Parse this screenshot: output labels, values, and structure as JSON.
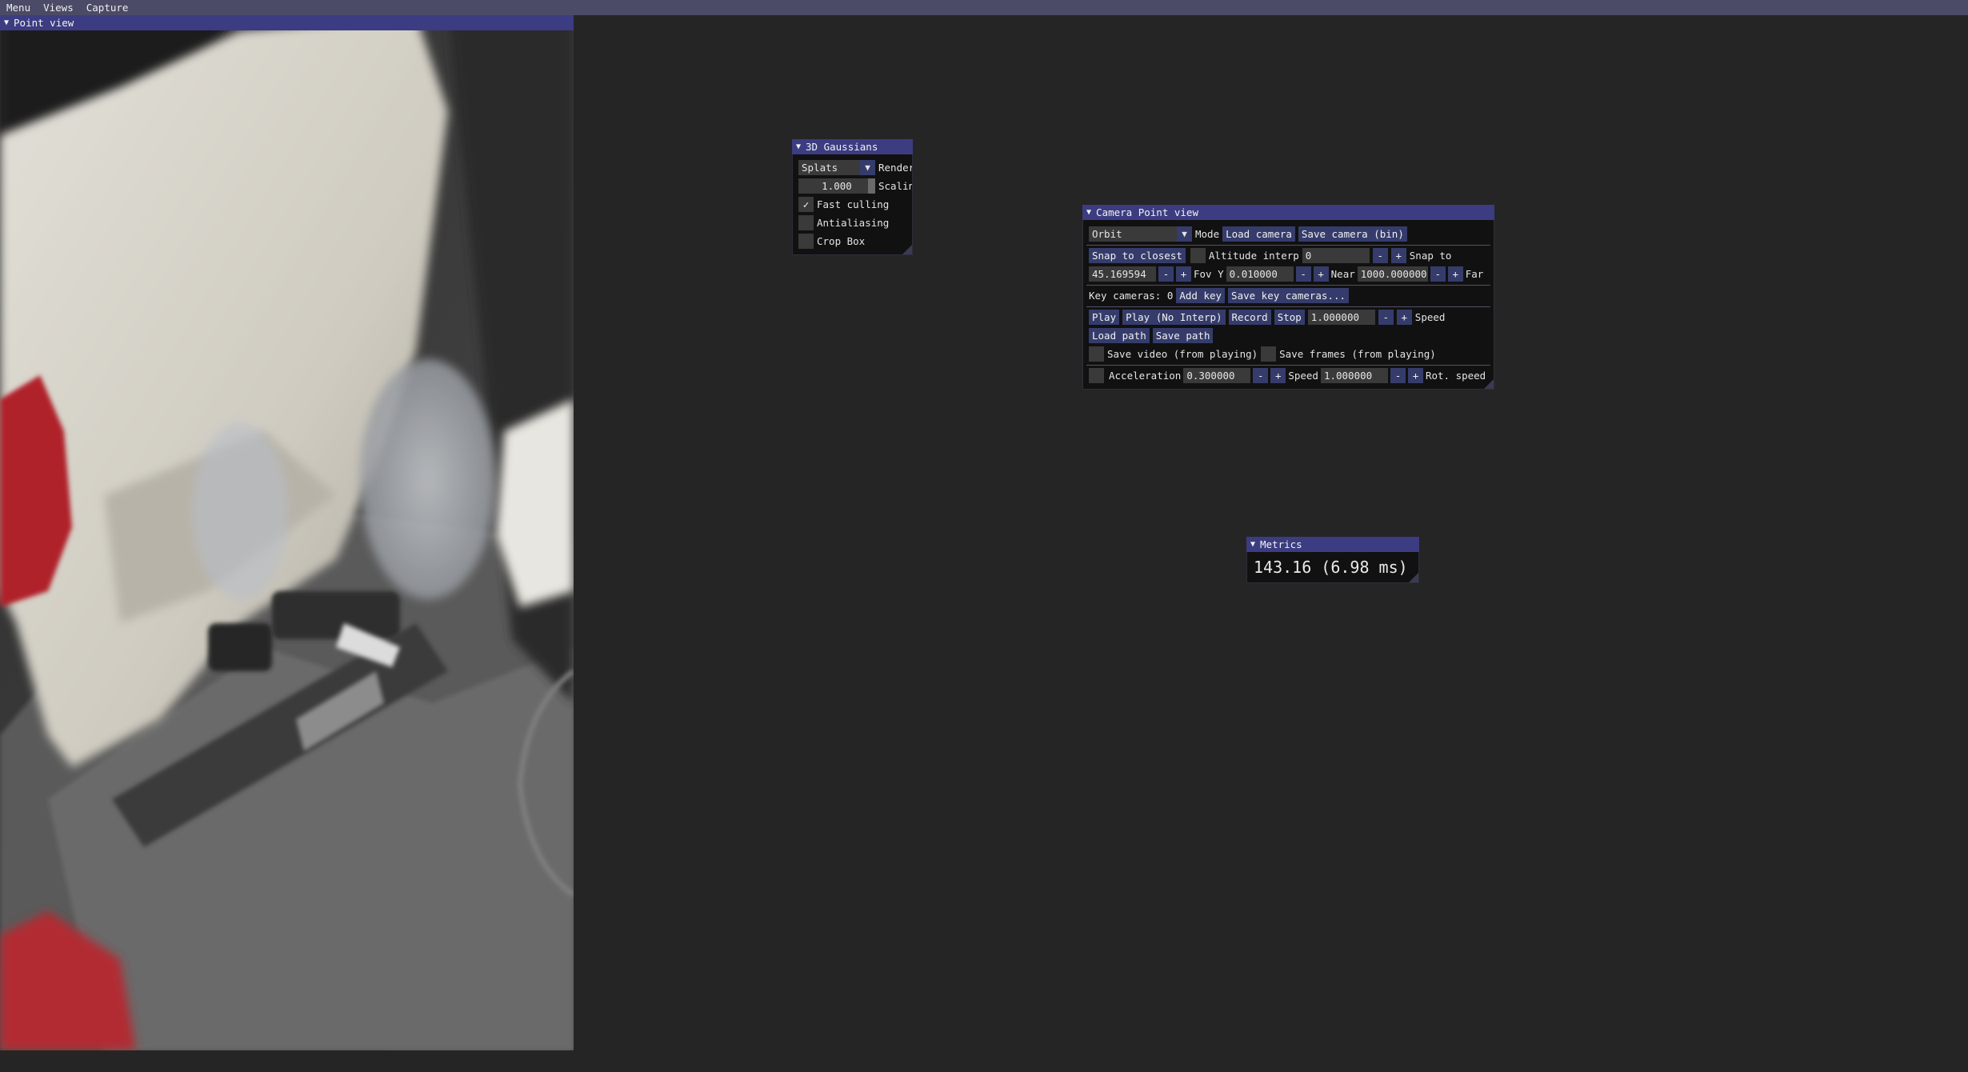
{
  "menubar": {
    "items": [
      "Menu",
      "Views",
      "Capture"
    ]
  },
  "point_view": {
    "title": "Point view"
  },
  "gaussians": {
    "title": "3D Gaussians",
    "render_mode": "Splats",
    "render_label": "Render",
    "scaling_value": "1.000",
    "scaling_label": "Scaling",
    "fast_culling": {
      "label": "Fast culling",
      "checked": true
    },
    "antialiasing": {
      "label": "Antialiasing",
      "checked": false
    },
    "crop_box": {
      "label": "Crop Box",
      "checked": false
    }
  },
  "camera": {
    "title": "Camera Point view",
    "mode_value": "Orbit",
    "mode_label": "Mode",
    "load_camera": "Load camera",
    "save_camera": "Save camera (bin)",
    "snap_closest": "Snap to closest",
    "altitude_label": "Altitude interp",
    "altitude_value": "0",
    "snap_to_label": "Snap to",
    "fov_value": "45.169594",
    "fov_label": "Fov Y",
    "near_value": "0.010000",
    "near_label": "Near",
    "far_value": "1000.000000",
    "far_label": "Far",
    "key_cameras": "Key cameras: 0",
    "add_key": "Add key",
    "save_key_cameras": "Save key cameras...",
    "play": "Play",
    "play_no_interp": "Play (No Interp)",
    "record": "Record",
    "stop": "Stop",
    "speed_value": "1.000000",
    "speed_label": "Speed",
    "load_path": "Load path",
    "save_path": "Save path",
    "save_video": "Save video (from playing)",
    "save_frames": "Save frames (from playing)",
    "acceleration_label": "Acceleration",
    "acceleration_value": "0.300000",
    "speed2_label": "Speed",
    "speed2_value": "1.000000",
    "rot_speed_label": "Rot. speed",
    "minus": "-",
    "plus": "+"
  },
  "metrics": {
    "title": "Metrics",
    "value": "143.16 (6.98 ms)"
  },
  "icons": {
    "collapse": "triangle-down-icon",
    "dropdown": "dropdown-arrow-icon",
    "check": "checkmark-icon"
  },
  "colors": {
    "menubar": "#4b4b68",
    "titlebar": "#3c3c82",
    "button": "#353c6b",
    "background": "#252525"
  }
}
